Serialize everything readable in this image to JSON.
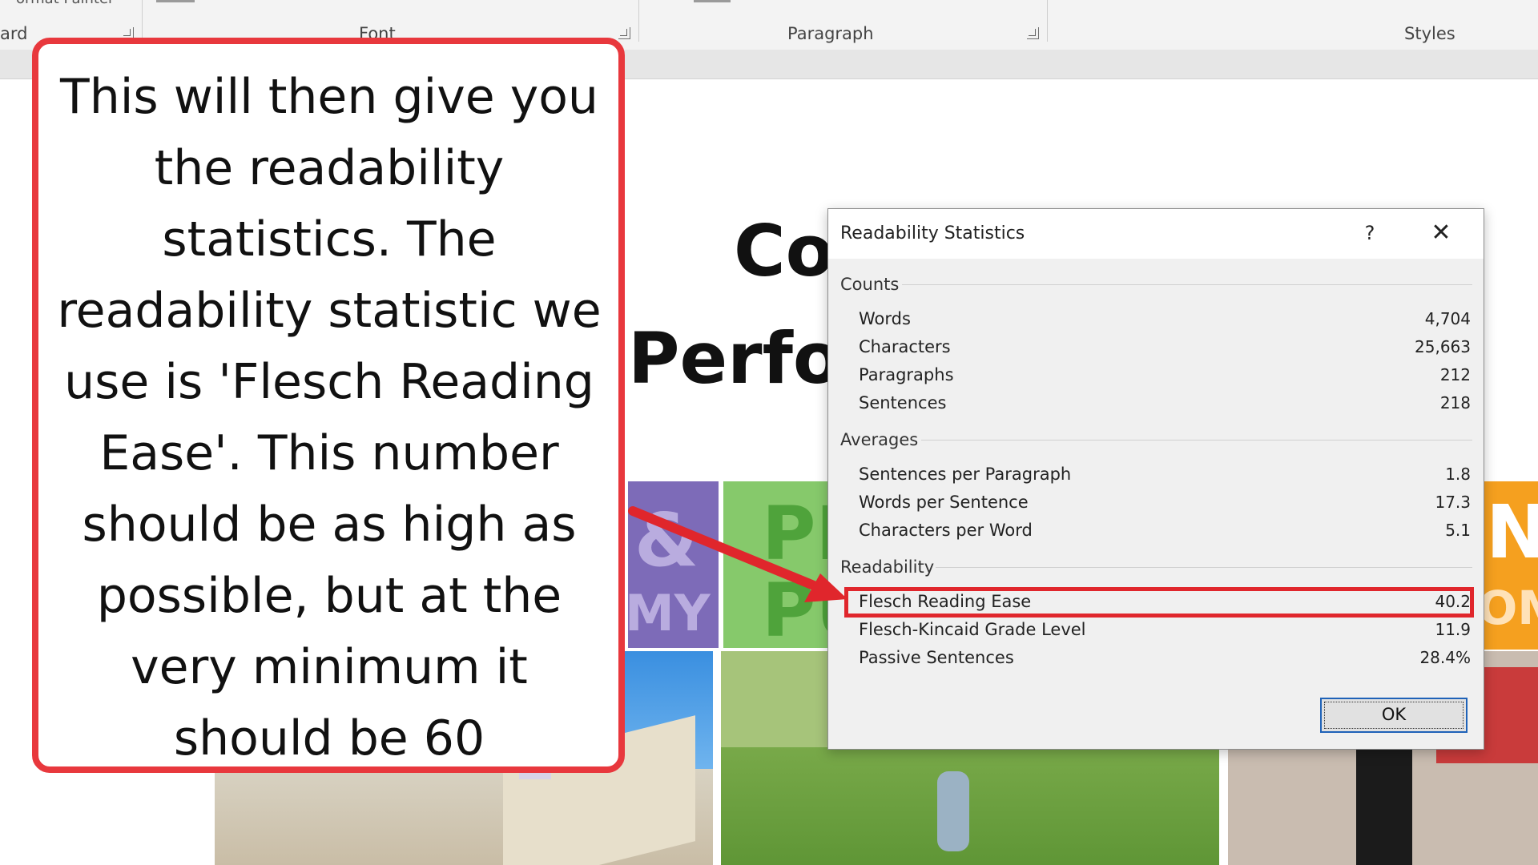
{
  "ribbon": {
    "cut_text": "ormat Painter",
    "groups": {
      "clipboard": "ard",
      "font": "Font",
      "paragraph": "Paragraph",
      "styles": "Styles"
    }
  },
  "document": {
    "title_line1": "Co",
    "title_line2": "Perfor",
    "tiles": {
      "purple_text": "&",
      "purple_sub": "MY",
      "green_text": "PE",
      "green_sub": "PU",
      "orange_text": "N",
      "orange_sub": "OMI"
    }
  },
  "callout": {
    "text": "This will then give you the readability statistics. The readability statistic we use is 'Flesch Reading Ease'. This number should be as high as possible, but at the very minimum it should be 60",
    "border_color": "#e8383d"
  },
  "dialog": {
    "title": "Readability Statistics",
    "help_icon": "?",
    "close_icon": "✕",
    "sections": {
      "counts": {
        "label": "Counts",
        "rows": [
          {
            "label": "Words",
            "value": "4,704"
          },
          {
            "label": "Characters",
            "value": "25,663"
          },
          {
            "label": "Paragraphs",
            "value": "212"
          },
          {
            "label": "Sentences",
            "value": "218"
          }
        ]
      },
      "averages": {
        "label": "Averages",
        "rows": [
          {
            "label": "Sentences per Paragraph",
            "value": "1.8"
          },
          {
            "label": "Words per Sentence",
            "value": "17.3"
          },
          {
            "label": "Characters per Word",
            "value": "5.1"
          }
        ]
      },
      "readability": {
        "label": "Readability",
        "rows": [
          {
            "label": "Flesch Reading Ease",
            "value": "40.2"
          },
          {
            "label": "Flesch-Kincaid Grade Level",
            "value": "11.9"
          },
          {
            "label": "Passive Sentences",
            "value": "28.4%"
          }
        ]
      }
    },
    "ok_label": "OK",
    "highlight_color": "#e0262c"
  }
}
